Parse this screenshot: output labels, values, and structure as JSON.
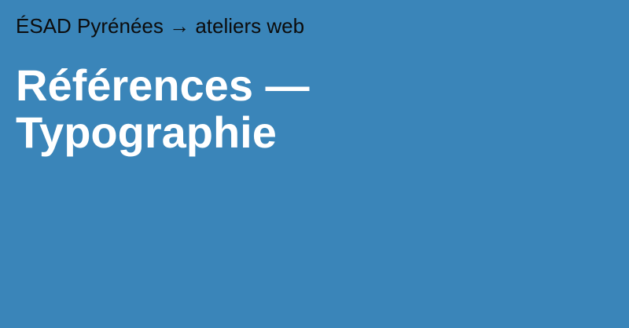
{
  "colors": {
    "background": "#3a85b9",
    "header_text": "#0c0c0c",
    "title_text": "#ffffff"
  },
  "header": {
    "site_name": "ÉSAD Pyrénées",
    "separator": "→",
    "section": "ateliers web"
  },
  "title": {
    "line1": "Références —",
    "line2": "Typographie"
  }
}
